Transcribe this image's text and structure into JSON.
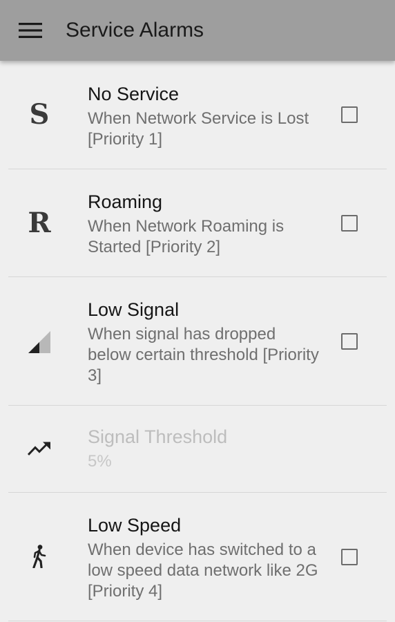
{
  "app_bar": {
    "title": "Service Alarms",
    "menu_icon": "hamburger-menu-icon"
  },
  "alarms": [
    {
      "title": "No Service",
      "description": "When Network Service is Lost [Priority 1]",
      "icon": "S",
      "checked": false
    },
    {
      "title": "Roaming",
      "description": "When Network Roaming is Started [Priority 2]",
      "icon": "R",
      "checked": false
    },
    {
      "title": "Low Signal",
      "description": "When signal has dropped below certain threshold [Priority 3]",
      "icon": "signal-strength-icon",
      "checked": false
    },
    {
      "title": "Signal Threshold",
      "value": "5%",
      "icon": "trending-up-icon",
      "enabled": false
    },
    {
      "title": "Low Speed",
      "description": "When device has switched to a low speed data network like 2G [Priority 4]",
      "icon": "walking-person-icon",
      "checked": false
    }
  ],
  "colors": {
    "app_bar": "#9e9e9e",
    "background": "#efefef",
    "divider": "#d6d6d6",
    "title_text": "#151515",
    "secondary_text": "#6f6f6f",
    "disabled_text": "#bdbdbd"
  }
}
